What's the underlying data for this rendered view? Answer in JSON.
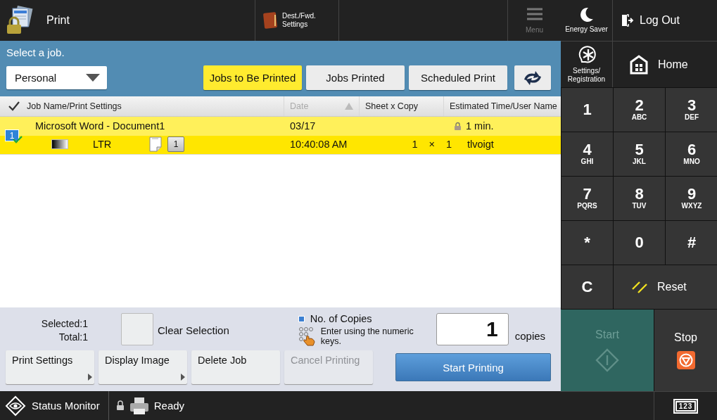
{
  "header": {
    "title": "Print",
    "dest_button": "Dest./Fwd.\nSettings",
    "menu_button": {
      "label": "Menu",
      "disabled": true
    }
  },
  "instruction": "Select a job.",
  "job_type_dropdown": {
    "value": "Personal"
  },
  "list_tabs": [
    {
      "label": "Jobs to Be Printed",
      "selected": true
    },
    {
      "label": "Jobs Printed",
      "selected": false
    },
    {
      "label": "Scheduled Print",
      "selected": false
    }
  ],
  "table": {
    "columns": [
      {
        "label": "Job Name/Print Settings",
        "sorted": false
      },
      {
        "label": "Date",
        "sorted": true
      },
      {
        "label": "Sheet x Copy",
        "sorted": false
      },
      {
        "label": "Estimated Time/User Name",
        "sorted": false
      }
    ],
    "rows": [
      {
        "selected": true,
        "job_number": "1",
        "name": "Microsoft Word - Document1",
        "paper": "LTR",
        "copy_badge": "1",
        "date": "03/17",
        "time": "10:40:08 AM",
        "sheets": "1",
        "times_sign": "×",
        "copies": "1",
        "locked": true,
        "estimated_time": "1 min.",
        "user": "tlvoigt"
      }
    ]
  },
  "summary": {
    "selected": "Selected:1",
    "total": "Total:1"
  },
  "clear_selection": {
    "label": "Clear Selection"
  },
  "copies": {
    "title": "No. of Copies",
    "hint": "Enter using the numeric keys.",
    "value": "1",
    "unit": "copies"
  },
  "actions": [
    {
      "label": "Print Settings",
      "submenu": true,
      "disabled": false
    },
    {
      "label": "Display Image",
      "submenu": true,
      "disabled": false
    },
    {
      "label": "Delete Job",
      "submenu": false,
      "disabled": false
    },
    {
      "label": "Cancel Printing",
      "submenu": false,
      "disabled": true
    }
  ],
  "start_printing": "Start Printing",
  "status_bar": {
    "status_monitor": "Status Monitor",
    "status": "Ready"
  },
  "side": {
    "energy_saver": "Energy Saver",
    "log_out": "Log Out",
    "settings_registration": "Settings/\nRegistration",
    "home": "Home"
  },
  "keypad": [
    {
      "key": "1"
    },
    {
      "key": "2",
      "letters": "ABC"
    },
    {
      "key": "3",
      "letters": "DEF"
    },
    {
      "key": "4",
      "letters": "GHI"
    },
    {
      "key": "5",
      "letters": "JKL"
    },
    {
      "key": "6",
      "letters": "MNO"
    },
    {
      "key": "7",
      "letters": "PQRS"
    },
    {
      "key": "8",
      "letters": "TUV"
    },
    {
      "key": "9",
      "letters": "WXYZ"
    },
    {
      "key": "*"
    },
    {
      "key": "0"
    },
    {
      "key": "#"
    }
  ],
  "clear_key": "C",
  "reset": "Reset",
  "start": {
    "label": "Start",
    "disabled": true
  },
  "stop": "Stop",
  "counter_key": "123"
}
